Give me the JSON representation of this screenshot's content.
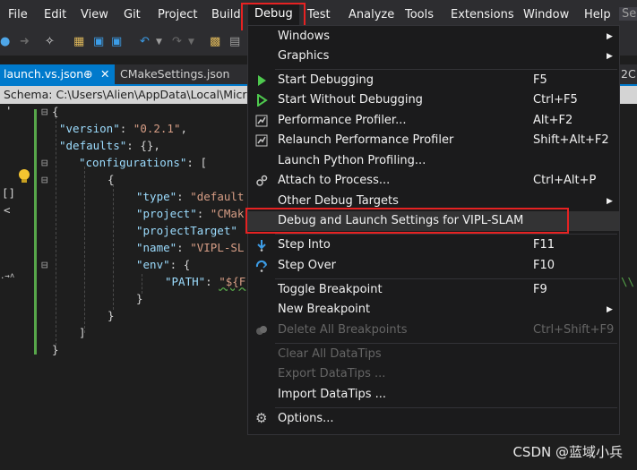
{
  "menubar": {
    "items": [
      "File",
      "Edit",
      "View",
      "Git",
      "Project",
      "Build",
      "Debug",
      "Test",
      "Analyze",
      "Tools",
      "Extensions",
      "Window",
      "Help"
    ],
    "overflow": "Se"
  },
  "tabs": {
    "active": "launch.vs.json",
    "active_pin": "⊕",
    "active_close": "✕",
    "inactive": "CMakeSettings.json",
    "right_edge": "2C"
  },
  "schema": {
    "text": "Schema:  C:\\Users\\Alien\\AppData\\Local\\Micros"
  },
  "editor": {
    "lines": [
      "{",
      "  \"version\": \"0.2.1\",",
      "  \"defaults\": {},",
      "    \"configurations\": [",
      "      {",
      "        \"type\": \"default",
      "        \"project\": \"CMak",
      "        \"projectTarget\"",
      "        \"name\": \"VIPL-SL",
      "        \"env\": {",
      "          \"PATH\": \"${F",
      "        }",
      "      }",
      "    ]",
      "}"
    ],
    "gutter_marks": [
      "[]",
      "<",
      ".→˄"
    ]
  },
  "debug_menu": {
    "items": [
      {
        "label": "Windows",
        "shortcut": "",
        "submenu": true,
        "disabled": false,
        "icon": ""
      },
      {
        "label": "Graphics",
        "shortcut": "",
        "submenu": true,
        "disabled": false,
        "icon": ""
      },
      {
        "label": "Start Debugging",
        "shortcut": "F5",
        "submenu": false,
        "disabled": false,
        "icon": "play-icon"
      },
      {
        "label": "Start Without Debugging",
        "shortcut": "Ctrl+F5",
        "submenu": false,
        "disabled": false,
        "icon": "play-outline-icon"
      },
      {
        "label": "Performance Profiler...",
        "shortcut": "Alt+F2",
        "submenu": false,
        "disabled": false,
        "icon": "profiler-icon"
      },
      {
        "label": "Relaunch Performance Profiler",
        "shortcut": "Shift+Alt+F2",
        "submenu": false,
        "disabled": false,
        "icon": "relaunch-profiler-icon"
      },
      {
        "label": "Launch Python Profiling...",
        "shortcut": "",
        "submenu": false,
        "disabled": false,
        "icon": ""
      },
      {
        "label": "Attach to Process...",
        "shortcut": "Ctrl+Alt+P",
        "submenu": false,
        "disabled": false,
        "icon": "attach-gear-icon"
      },
      {
        "label": "Other Debug Targets",
        "shortcut": "",
        "submenu": true,
        "disabled": false,
        "icon": ""
      },
      {
        "label": "Debug and Launch Settings for VIPL-SLAM",
        "shortcut": "",
        "submenu": false,
        "disabled": false,
        "icon": ""
      },
      {
        "label": "Step Into",
        "shortcut": "F11",
        "submenu": false,
        "disabled": false,
        "icon": "step-into-icon"
      },
      {
        "label": "Step Over",
        "shortcut": "F10",
        "submenu": false,
        "disabled": false,
        "icon": "step-over-icon"
      },
      {
        "label": "Toggle Breakpoint",
        "shortcut": "F9",
        "submenu": false,
        "disabled": false,
        "icon": ""
      },
      {
        "label": "New Breakpoint",
        "shortcut": "",
        "submenu": true,
        "disabled": false,
        "icon": ""
      },
      {
        "label": "Delete All Breakpoints",
        "shortcut": "Ctrl+Shift+F9",
        "submenu": false,
        "disabled": true,
        "icon": "delete-breakpoints-icon"
      },
      {
        "label": "Clear All DataTips",
        "shortcut": "",
        "submenu": false,
        "disabled": true,
        "icon": ""
      },
      {
        "label": "Export DataTips ...",
        "shortcut": "",
        "submenu": false,
        "disabled": true,
        "icon": ""
      },
      {
        "label": "Import DataTips ...",
        "shortcut": "",
        "submenu": false,
        "disabled": false,
        "icon": ""
      },
      {
        "label": "Options...",
        "shortcut": "",
        "submenu": false,
        "disabled": false,
        "icon": "gear-icon"
      }
    ],
    "submenu_arrow": "▶"
  },
  "watermark": {
    "text": "CSDN @蓝域小兵"
  },
  "colors": {
    "menubar_bg": "#2d2d30",
    "menu_bg": "#1b1b1c",
    "accent": "#007acc",
    "highlight_box": "#e62222",
    "play_green": "#4ec94e",
    "step_blue": "#3c9ce6"
  }
}
